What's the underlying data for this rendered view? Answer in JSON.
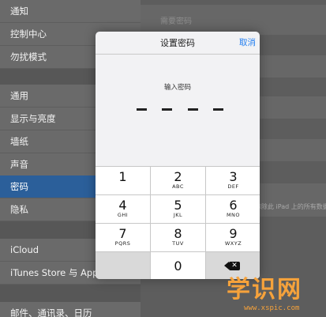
{
  "sidebar": {
    "items": [
      {
        "label": "通知"
      },
      {
        "label": "控制中心"
      },
      {
        "label": "勿扰模式"
      },
      {
        "label": "通用"
      },
      {
        "label": "显示与亮度"
      },
      {
        "label": "墙纸"
      },
      {
        "label": "声音"
      },
      {
        "label": "密码",
        "selected": true
      },
      {
        "label": "隐私"
      },
      {
        "label": "iCloud"
      },
      {
        "label": "iTunes Store 与 App Store"
      },
      {
        "label": "邮件、通讯录、日历"
      }
    ]
  },
  "main": {
    "require_passcode_label": "需要密码",
    "erase_note": "抹除此 iPad 上的所有数据"
  },
  "dialog": {
    "title": "设置密码",
    "cancel_label": "取消",
    "prompt": "输入密码",
    "entered_digits": 0
  },
  "keypad": {
    "keys": [
      {
        "digit": "1",
        "letters": ""
      },
      {
        "digit": "2",
        "letters": "ABC"
      },
      {
        "digit": "3",
        "letters": "DEF"
      },
      {
        "digit": "4",
        "letters": "GHI"
      },
      {
        "digit": "5",
        "letters": "JKL"
      },
      {
        "digit": "6",
        "letters": "MNO"
      },
      {
        "digit": "7",
        "letters": "PQRS"
      },
      {
        "digit": "8",
        "letters": "TUV"
      },
      {
        "digit": "9",
        "letters": "WXYZ"
      },
      {
        "digit": "0",
        "letters": ""
      }
    ],
    "delete_icon": "backspace-icon"
  },
  "watermark": {
    "main": "学识网",
    "sub": "www.xspic.com"
  },
  "colors": {
    "selected_row": "#2b5f9a",
    "accent": "#1e7cf0",
    "watermark": "#f6a23b"
  }
}
